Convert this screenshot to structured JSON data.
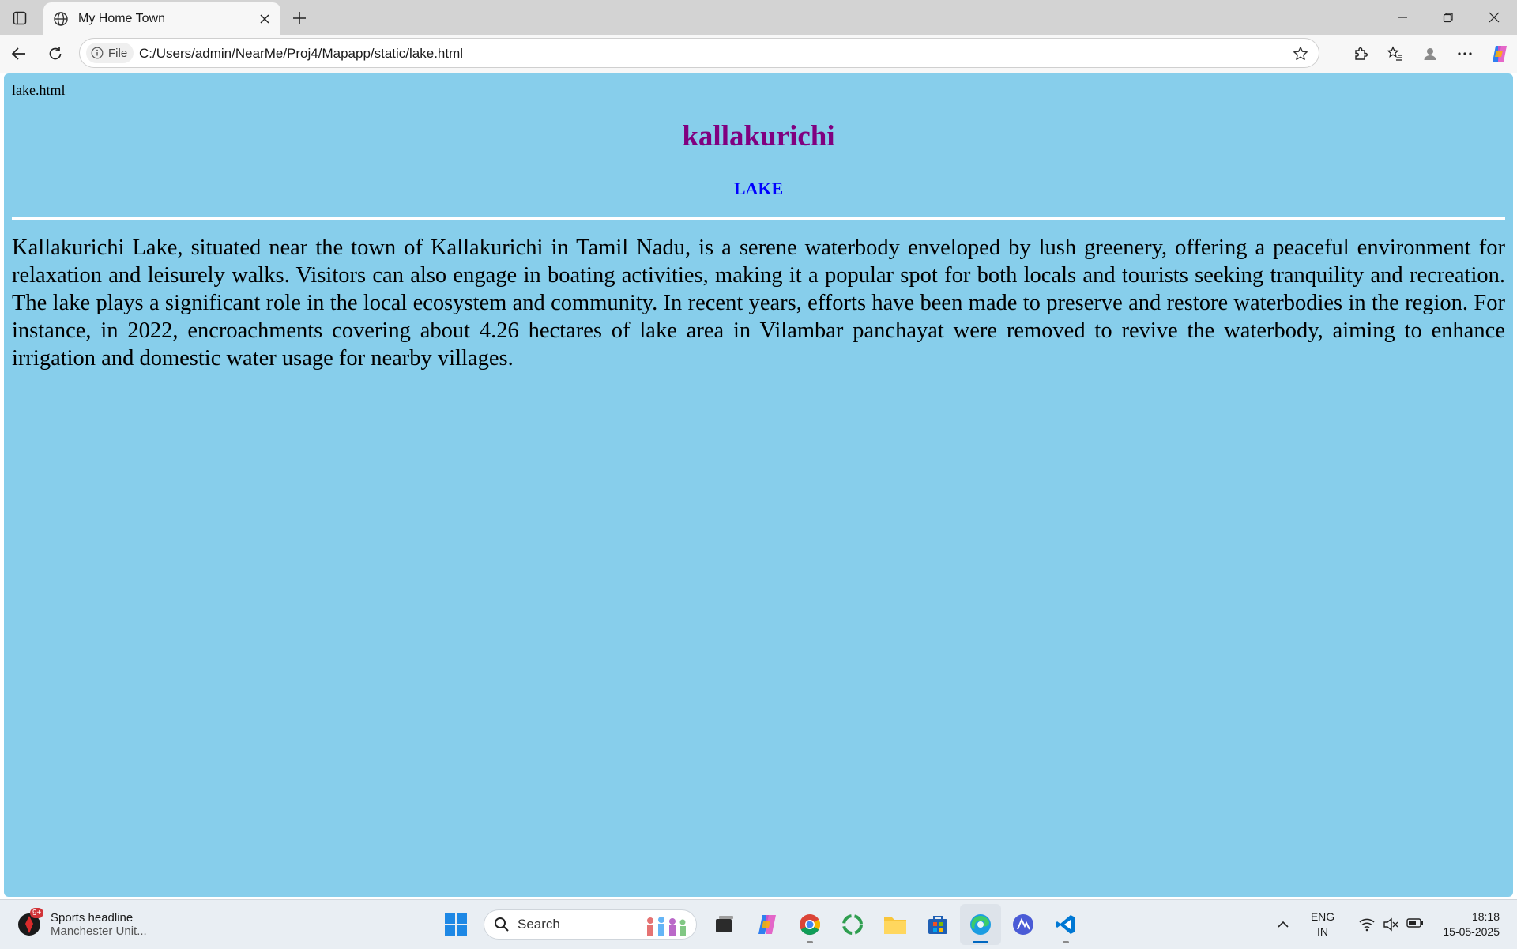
{
  "browser": {
    "tab_title": "My Home Town",
    "site_info_label": "File",
    "url": "C:/Users/admin/NearMe/Proj4/Mapapp/static/lake.html"
  },
  "page": {
    "file_label": "lake.html",
    "heading": "kallakurichi",
    "subheading": "LAKE",
    "body": "Kallakurichi Lake, situated near the town of Kallakurichi in Tamil Nadu, is a serene waterbody enveloped by lush greenery, offering a peaceful environment for relaxation and leisurely walks. Visitors can also engage in boating activities, making it a popular spot for both locals and tourists seeking tranquility and recreation. The lake plays a significant role in the local ecosystem and community. In recent years, efforts have been made to preserve and restore waterbodies in the region. For instance, in 2022, encroachments covering about 4.26 hectares of lake area in Vilambar panchayat were removed to revive the waterbody, aiming to enhance irrigation and domestic water usage for nearby villages.",
    "background_color": "#87ceeb",
    "heading_color": "#800080",
    "subheading_color": "#0000ff"
  },
  "taskbar": {
    "widget_title": "Sports headline",
    "widget_subtitle": "Manchester Unit...",
    "widget_badge": "9+",
    "search_label": "Search",
    "lang_top": "ENG",
    "lang_bottom": "IN",
    "time": "18:18",
    "date": "15-05-2025",
    "apps": [
      "task-view",
      "copilot",
      "chrome",
      "refresh-app",
      "file-explorer",
      "store",
      "edge",
      "dev-app",
      "vscode"
    ]
  }
}
